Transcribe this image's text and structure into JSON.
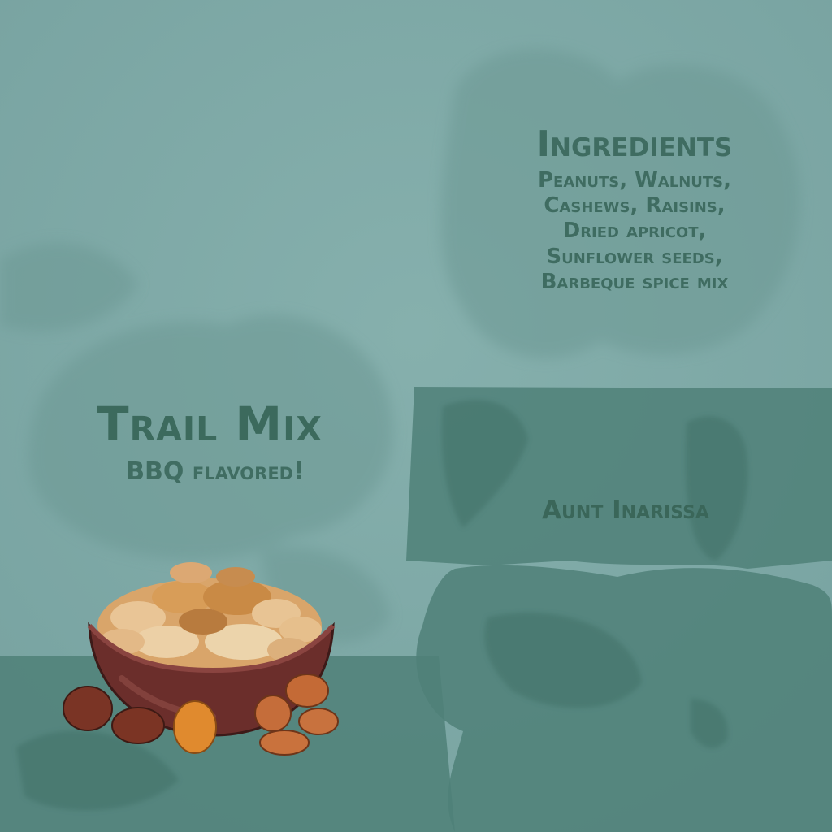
{
  "product": {
    "title": "Trail Mix",
    "subtitle": "BBQ flavored!"
  },
  "ingredients": {
    "heading": "Ingredients",
    "lines": [
      "Peanuts, Walnuts,",
      "Cashews, Raisins,",
      "Dried apricot,",
      "Sunflower seeds,",
      "Barbeque spice mix"
    ]
  },
  "author": "Aunt Inarissa",
  "icons": {
    "illustration": "nut-bowl-icon"
  },
  "colors": {
    "background": "#7fa9a7",
    "panel": "#4f8078",
    "text": "#3f6c61"
  }
}
